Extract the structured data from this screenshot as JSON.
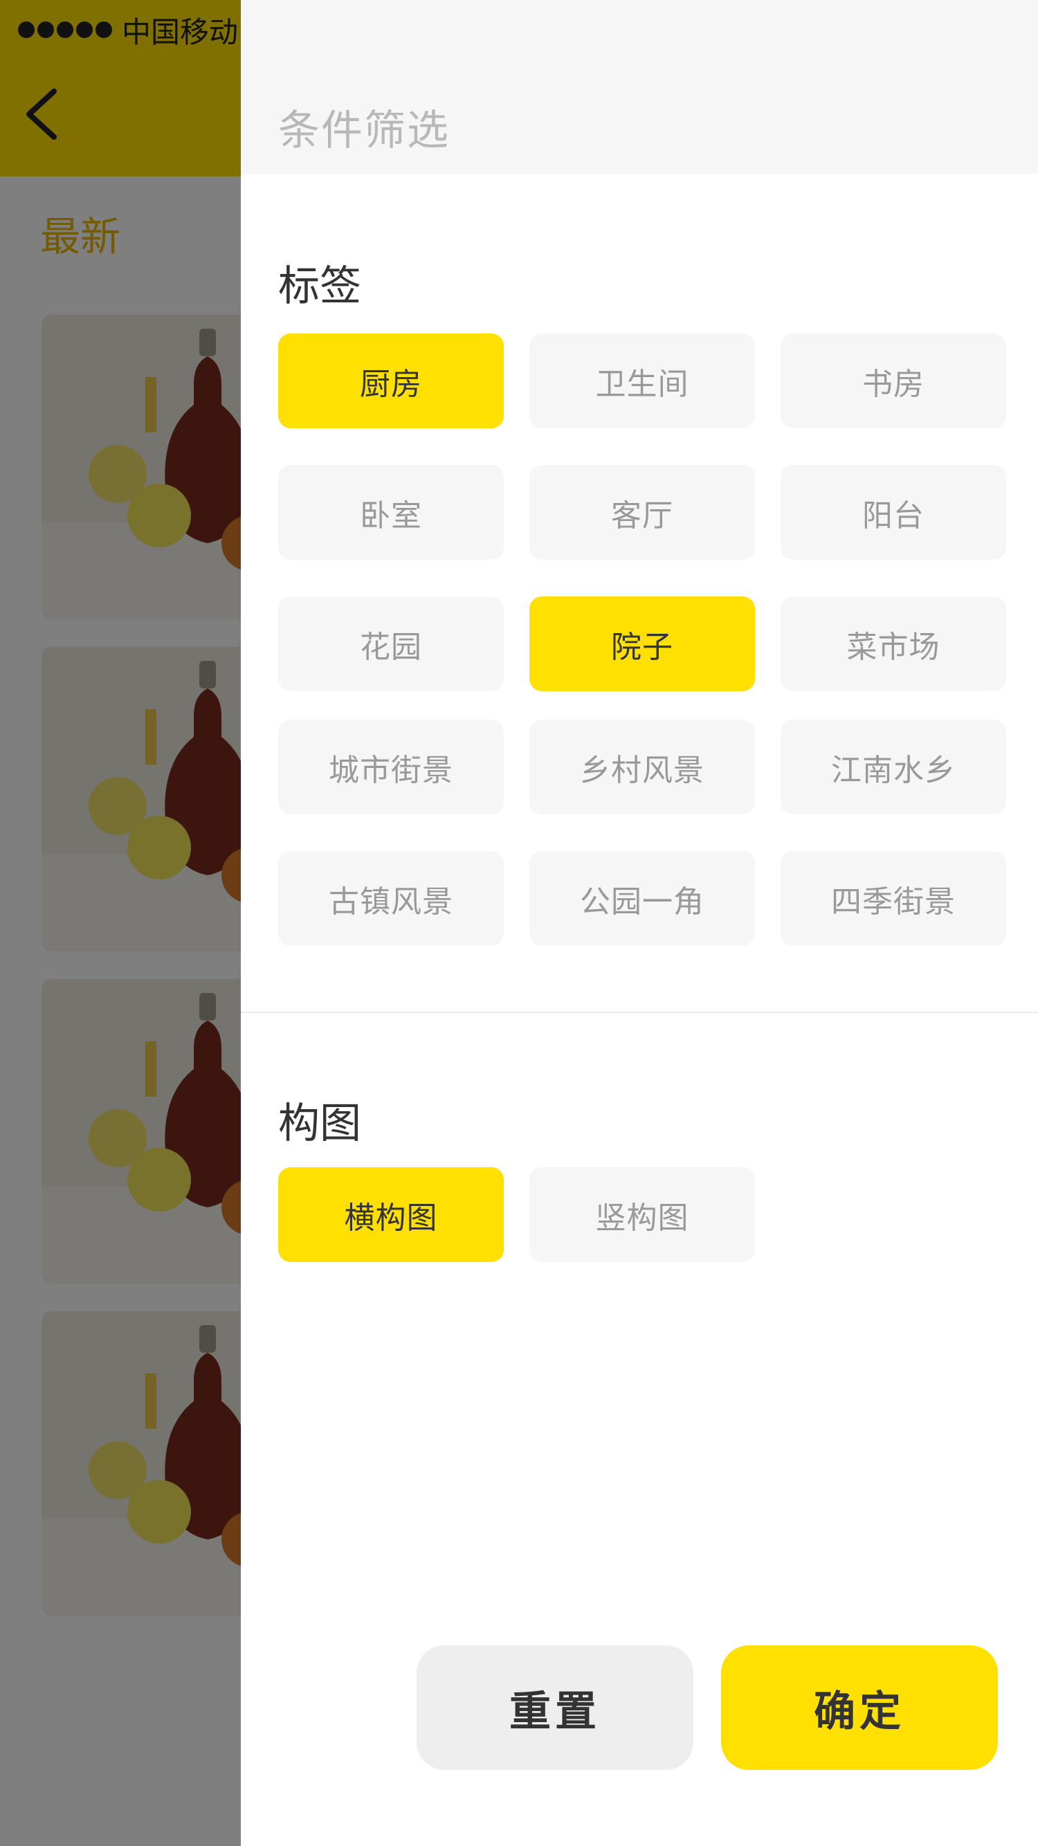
{
  "background": {
    "status_bar": {
      "carrier": "中国移动"
    },
    "tab_latest": "最新"
  },
  "drawer": {
    "title": "条件筛选",
    "sections": [
      {
        "title": "标签",
        "chips": [
          {
            "label": "厨房",
            "selected": true
          },
          {
            "label": "卫生间",
            "selected": false
          },
          {
            "label": "书房",
            "selected": false
          },
          {
            "label": "卧室",
            "selected": false
          },
          {
            "label": "客厅",
            "selected": false
          },
          {
            "label": "阳台",
            "selected": false
          },
          {
            "label": "花园",
            "selected": false
          },
          {
            "label": "院子",
            "selected": true
          },
          {
            "label": "菜市场",
            "selected": false
          },
          {
            "label": "城市街景",
            "selected": false
          },
          {
            "label": "乡村风景",
            "selected": false
          },
          {
            "label": "江南水乡",
            "selected": false
          },
          {
            "label": "古镇风景",
            "selected": false
          },
          {
            "label": "公园一角",
            "selected": false
          },
          {
            "label": "四季街景",
            "selected": false
          }
        ]
      },
      {
        "title": "构图",
        "chips": [
          {
            "label": "横构图",
            "selected": true
          },
          {
            "label": "竖构图",
            "selected": false
          }
        ]
      }
    ],
    "buttons": {
      "reset": "重置",
      "confirm": "确定"
    }
  },
  "colors": {
    "accent": "#FFE000",
    "chip_bg": "#F6F6F6",
    "chip_text": "#999999",
    "overlay": "rgba(0,0,0,0.5)"
  }
}
